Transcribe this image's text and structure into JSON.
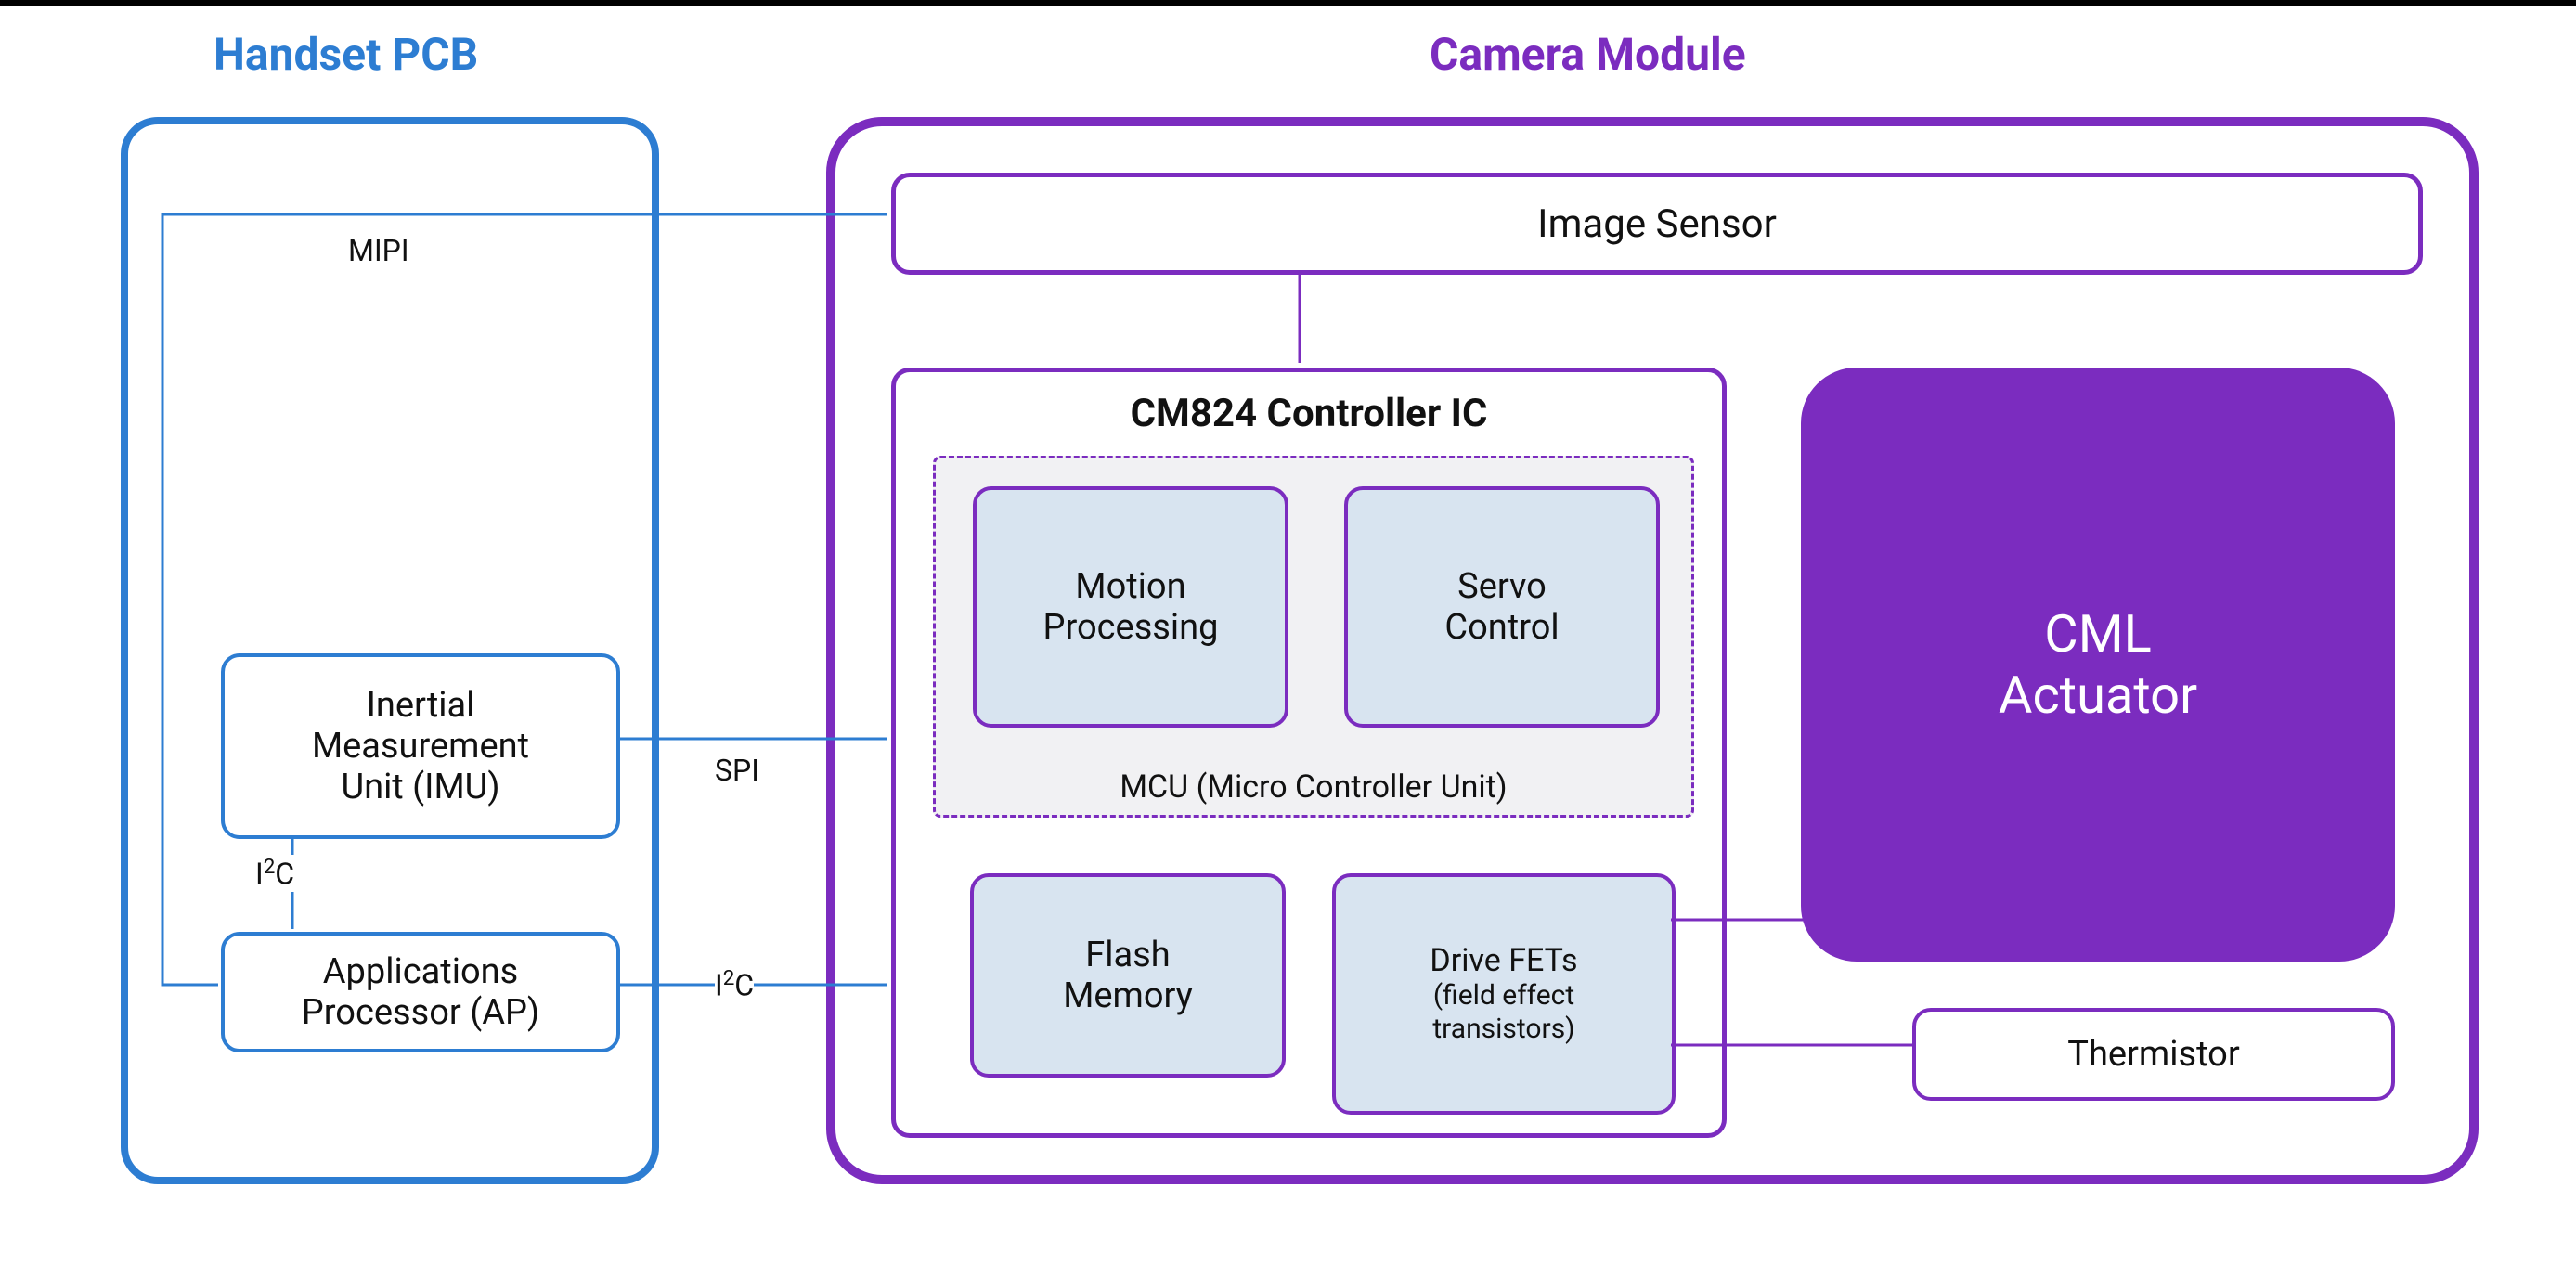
{
  "titles": {
    "handset": "Handset PCB",
    "camera": "Camera Module"
  },
  "handset": {
    "imu": "Inertial\nMeasurement\nUnit (IMU)",
    "ap": "Applications\nProcessor (AP)"
  },
  "camera": {
    "image_sensor": "Image Sensor",
    "controller_title": "CM824 Controller IC",
    "mcu_label": "MCU (Micro Controller Unit)",
    "motion": "Motion\nProcessing",
    "servo": "Servo\nControl",
    "flash": "Flash\nMemory",
    "fets_main": "Drive FETs",
    "fets_sub": "(field effect\ntransistors)",
    "actuator": "CML\nActuator",
    "thermistor": "Thermistor"
  },
  "bus": {
    "mipi": "MIPI",
    "spi": "SPI",
    "i2c": "I²C"
  },
  "diagram": {
    "connections": [
      {
        "from": "Applications Processor (AP)",
        "to": "Image Sensor",
        "bus": "MIPI",
        "path": "AP-left -> up -> right -> Image Sensor left"
      },
      {
        "from": "Inertial Measurement Unit (IMU)",
        "to": "CM824 Controller IC",
        "bus": "SPI"
      },
      {
        "from": "Applications Processor (AP)",
        "to": "CM824 Controller IC",
        "bus": "I²C"
      },
      {
        "from": "Applications Processor (AP)",
        "to": "Inertial Measurement Unit (IMU)",
        "bus": "I²C"
      },
      {
        "from": "Image Sensor",
        "to": "CM824 Controller IC",
        "bus": ""
      },
      {
        "from": "Drive FETs",
        "to": "CML Actuator",
        "bus": ""
      },
      {
        "from": "Drive FETs",
        "to": "Thermistor",
        "bus": ""
      }
    ]
  }
}
